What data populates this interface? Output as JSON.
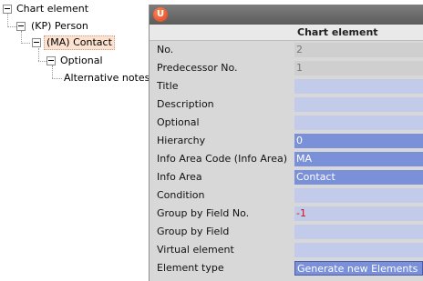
{
  "tree": {
    "root": "Chart element",
    "person": "(KP) Person",
    "contact": "(MA) Contact",
    "optional": "Optional",
    "notes": "Alternative notes"
  },
  "window": {
    "logo": "U",
    "header": "Chart element",
    "fields": [
      {
        "label": "No.",
        "value": "2",
        "style": "readonly"
      },
      {
        "label": "Predecessor No.",
        "value": "1",
        "style": "readonly"
      },
      {
        "label": "Title",
        "value": "",
        "style": "empty"
      },
      {
        "label": "Description",
        "value": "",
        "style": "empty"
      },
      {
        "label": "Optional",
        "value": "",
        "style": "empty"
      },
      {
        "label": "Hierarchy",
        "value": "0",
        "style": "filled"
      },
      {
        "label": "Info Area Code (Info Area)",
        "value": "MA",
        "style": "filled"
      },
      {
        "label": "Info Area",
        "value": "Contact",
        "style": "filled"
      },
      {
        "label": "Condition",
        "value": "",
        "style": "empty"
      },
      {
        "label": "Group by Field No.",
        "value": "-1",
        "style": "negative"
      },
      {
        "label": "Group by Field",
        "value": "",
        "style": "empty"
      },
      {
        "label": "Virtual element",
        "value": "",
        "style": "empty"
      },
      {
        "label": "Element type",
        "value": "Generate new Elements",
        "style": "select"
      }
    ]
  }
}
